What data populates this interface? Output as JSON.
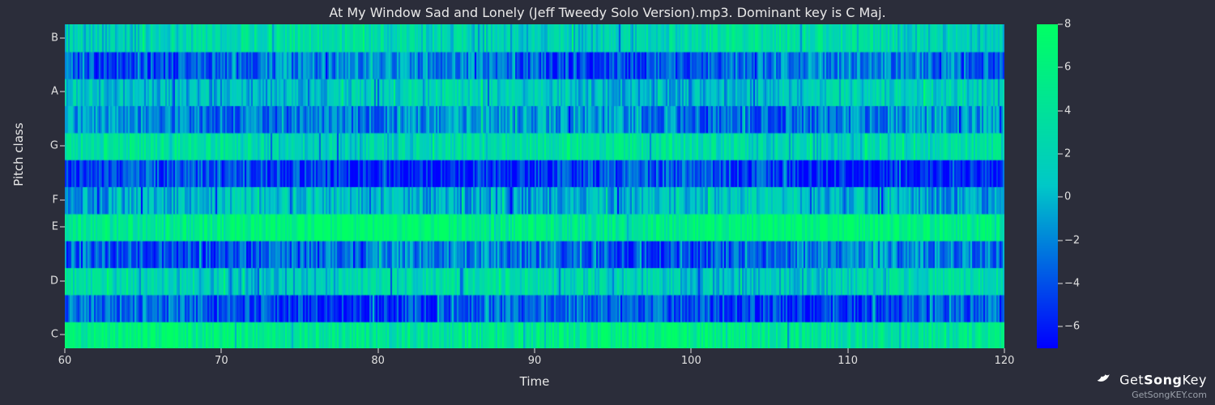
{
  "title": "At My Window Sad and Lonely (Jeff Tweedy Solo Version).mp3. Dominant key is C Maj.",
  "ylabel": "Pitch class",
  "xlabel": "Time",
  "watermark": {
    "brand": "GetSongKey",
    "url": "GetSongKEY.com"
  },
  "chart_data": {
    "type": "heatmap",
    "title": "At My Window Sad and Lonely (Jeff Tweedy Solo Version).mp3. Dominant key is C Maj.",
    "xlabel": "Time",
    "ylabel": "Pitch class",
    "x_range": [
      60,
      120
    ],
    "x_ticks": [
      60,
      70,
      80,
      90,
      100,
      110,
      120
    ],
    "y_categories": [
      "C",
      "C#",
      "D",
      "D#",
      "E",
      "F",
      "F#",
      "G",
      "G#",
      "A",
      "A#",
      "B"
    ],
    "y_tick_labels": [
      "C",
      "D",
      "E",
      "F",
      "G",
      "A",
      "B"
    ],
    "colorbar": {
      "range": [
        -7,
        8
      ],
      "ticks": [
        -6,
        -4,
        -2,
        0,
        2,
        4,
        6,
        8
      ]
    },
    "colormap": "winter_like_blue_to_green",
    "row_means": {
      "C": 5.0,
      "C#": -4.0,
      "D": 2.0,
      "D#": -3.0,
      "E": 6.0,
      "F": 0.0,
      "F#": -5.0,
      "G": 3.0,
      "G#": -2.0,
      "A": 1.0,
      "A#": -3.0,
      "B": 2.5
    },
    "note": "Dense chromagram-style heatmap; values are approximate per-row averages on the displayed color scale."
  }
}
